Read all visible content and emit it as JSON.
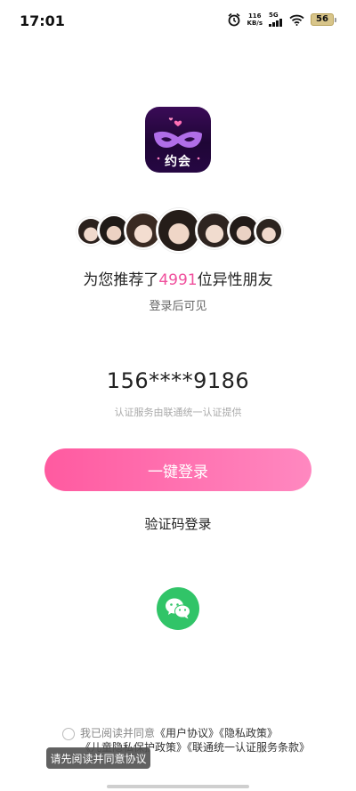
{
  "status_bar": {
    "time": "17:01",
    "net_speed_value": "116",
    "net_speed_unit": "KB/s",
    "signal_label": "5G",
    "battery": "56"
  },
  "app": {
    "logo_text": "约会",
    "brand_color": "#f0509d"
  },
  "recommend": {
    "prefix": "为您推荐了",
    "count": "4991",
    "suffix": "位异性朋友",
    "after_login": "登录后可见"
  },
  "phone": {
    "masked_number": "156****9186",
    "provider_note": "认证服务由联通统一认证提供"
  },
  "actions": {
    "one_click_login": "一键登录",
    "code_login": "验证码登录",
    "wechat_icon": "wechat-icon"
  },
  "agreement": {
    "prefix": "我已阅读并同意",
    "user_agreement": "《用户协议》",
    "privacy_policy": "《隐私政策》",
    "children_policy": "《儿童隐私保护政策》",
    "unicom_terms": "《联通统一认证服务条款》",
    "tooltip": "请先阅读并同意协议"
  }
}
